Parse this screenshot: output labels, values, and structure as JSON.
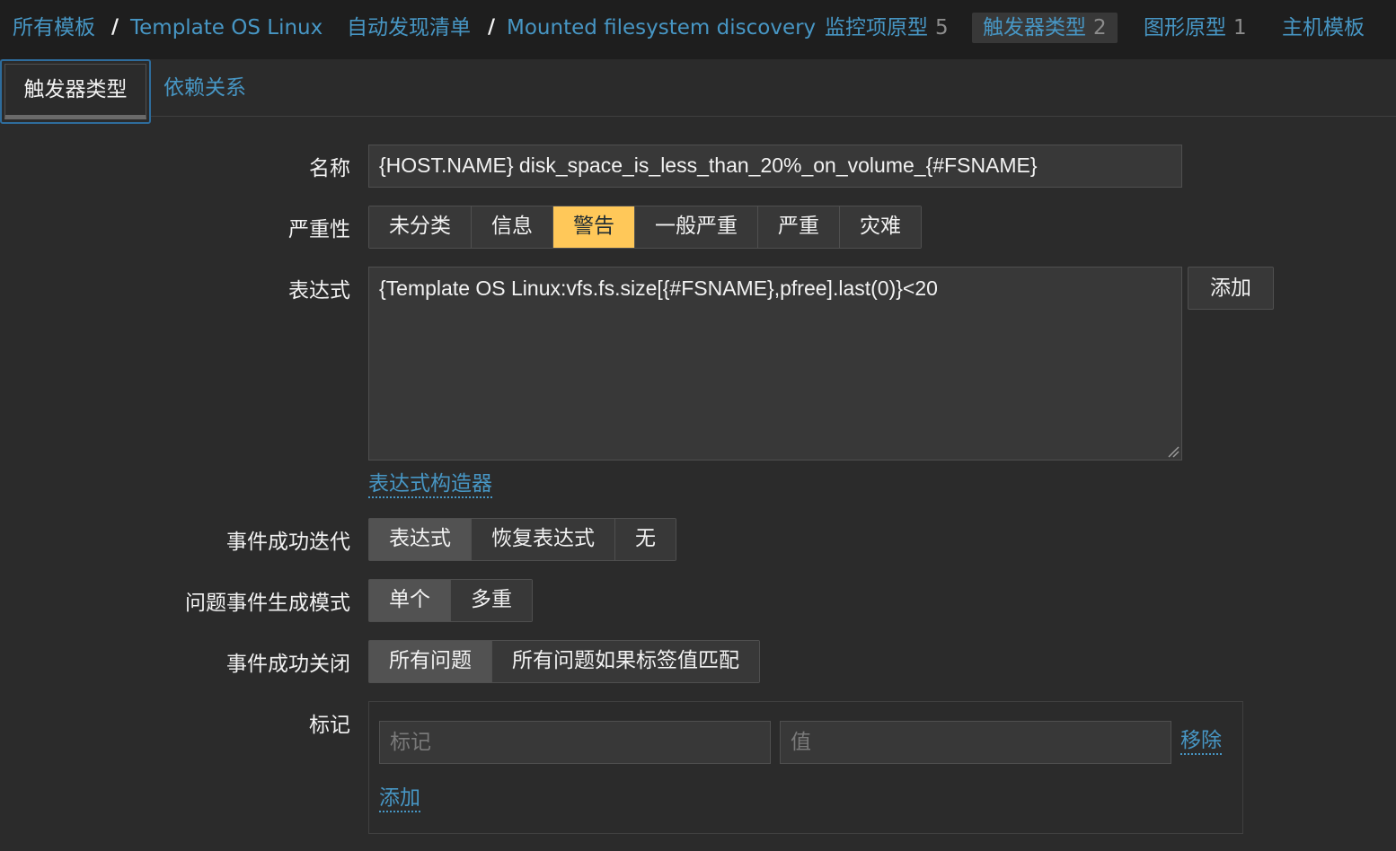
{
  "breadcrumb": {
    "all_templates": "所有模板",
    "template": "Template OS Linux",
    "discovery_list": "自动发现清单",
    "discovery_rule": "Mounted filesystem discovery",
    "item_prototypes": "监控项原型",
    "item_prototypes_count": "5",
    "trigger_prototypes": "触发器类型",
    "trigger_prototypes_count": "2",
    "graph_prototypes": "图形原型",
    "graph_prototypes_count": "1",
    "host_templates": "主机模板",
    "separator": "/"
  },
  "tabs": {
    "trigger": "触发器类型",
    "dependencies": "依赖关系"
  },
  "form": {
    "name_label": "名称",
    "name_value": "{HOST.NAME} disk_space_is_less_than_20%_on_volume_{#FSNAME}",
    "severity_label": "严重性",
    "severity_options": [
      "未分类",
      "信息",
      "警告",
      "一般严重",
      "严重",
      "灾难"
    ],
    "severity_selected": "警告",
    "expression_label": "表达式",
    "expression_value": "{Template OS Linux:vfs.fs.size[{#FSNAME},pfree].last(0)}<20",
    "expression_add": "添加",
    "expression_builder": "表达式构造器",
    "ok_event_gen_label": "事件成功迭代",
    "ok_event_gen_options": [
      "表达式",
      "恢复表达式",
      "无"
    ],
    "problem_mode_label": "问题事件生成模式",
    "problem_mode_options": [
      "单个",
      "多重"
    ],
    "ok_close_label": "事件成功关闭",
    "ok_close_options": [
      "所有问题",
      "所有问题如果标签值匹配"
    ],
    "tags_label": "标记",
    "tag_placeholder": "标记",
    "value_placeholder": "值",
    "tag_remove": "移除",
    "tag_add": "添加"
  },
  "colors": {
    "background": "#2b2b2b",
    "nav_background": "#1e1e1e",
    "link": "#4796c4",
    "warning": "#ffc859",
    "selected_segment": "#525252",
    "input": "#383838"
  }
}
